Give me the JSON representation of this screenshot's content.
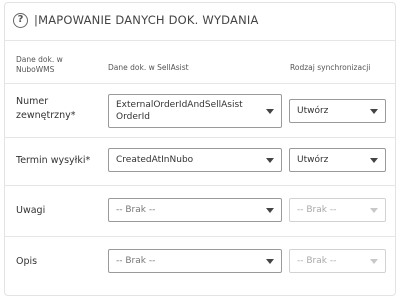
{
  "header": {
    "title": "|MAPOWANIE DANYCH DOK. WYDANIA",
    "help_icon": "question-circle-icon"
  },
  "columns": {
    "nubo_line1": "Dane dok. w",
    "nubo_line2": "NuboWMS",
    "sellasist": "Dane dok. w SellAsist",
    "sync": "Rodzaj synchronizacji"
  },
  "rows": [
    {
      "label_line1": "Numer",
      "label_line2": "zewnętrzny*",
      "value_line1": "ExternalOrderIdAndSellAsist",
      "value_line2": "OrderId",
      "sync": "Utwórz"
    },
    {
      "label_line1": "Termin wysyłki*",
      "label_line2": "",
      "value_line1": "CreatedAtInNubo",
      "value_line2": "",
      "sync": "Utwórz"
    },
    {
      "label_line1": "Uwagi",
      "label_line2": "",
      "value_line1": "-- Brak --",
      "value_line2": "",
      "sync": "-- Brak --"
    },
    {
      "label_line1": "Opis",
      "label_line2": "",
      "value_line1": "-- Brak --",
      "value_line2": "",
      "sync": "-- Brak --"
    }
  ]
}
